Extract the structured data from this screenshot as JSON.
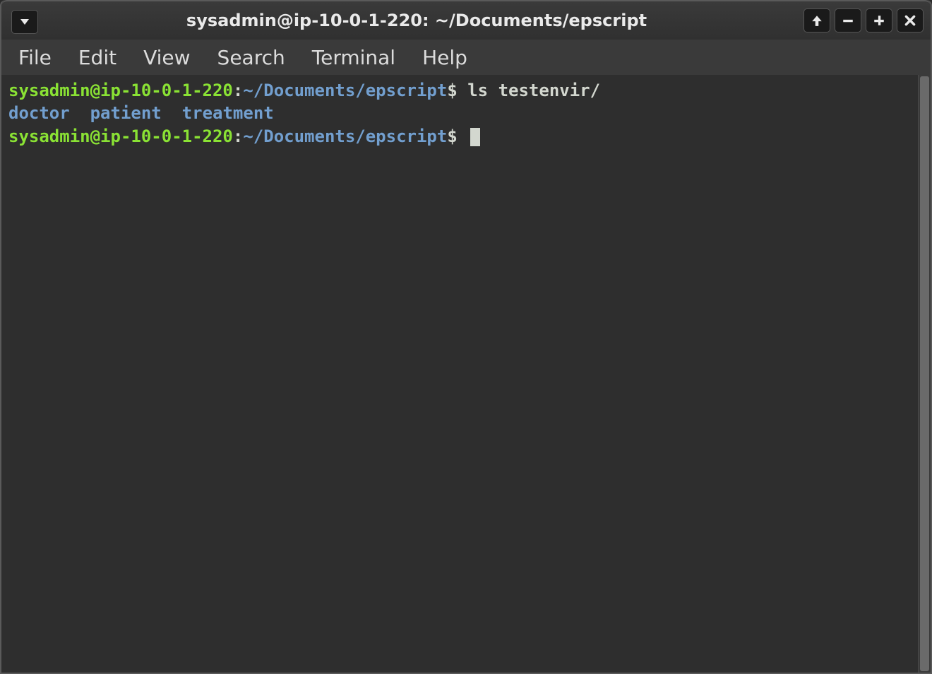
{
  "window": {
    "title": "sysadmin@ip-10-0-1-220: ~/Documents/epscript"
  },
  "menubar": {
    "items": [
      "File",
      "Edit",
      "View",
      "Search",
      "Terminal",
      "Help"
    ]
  },
  "terminal": {
    "lines": [
      {
        "segments": [
          {
            "text": "sysadmin@ip-10-0-1-220",
            "cls": "c-green"
          },
          {
            "text": ":",
            "cls": "c-white"
          },
          {
            "text": "~/Documents/epscript",
            "cls": "c-blue"
          },
          {
            "text": "$ ",
            "cls": "c-white"
          },
          {
            "text": "ls testenvir/",
            "cls": "c-white"
          }
        ]
      },
      {
        "segments": [
          {
            "text": "doctor",
            "cls": "c-dirblue"
          },
          {
            "text": "  ",
            "cls": "c-white"
          },
          {
            "text": "patient",
            "cls": "c-dirblue"
          },
          {
            "text": "  ",
            "cls": "c-white"
          },
          {
            "text": "treatment",
            "cls": "c-dirblue"
          }
        ]
      },
      {
        "segments": [
          {
            "text": "sysadmin@ip-10-0-1-220",
            "cls": "c-green"
          },
          {
            "text": ":",
            "cls": "c-white"
          },
          {
            "text": "~/Documents/epscript",
            "cls": "c-blue"
          },
          {
            "text": "$ ",
            "cls": "c-white"
          }
        ],
        "cursor": true
      }
    ]
  },
  "icons": {
    "dropdown": "▼",
    "up": "↑",
    "minimize": "−",
    "maximize": "+",
    "close": "×"
  }
}
